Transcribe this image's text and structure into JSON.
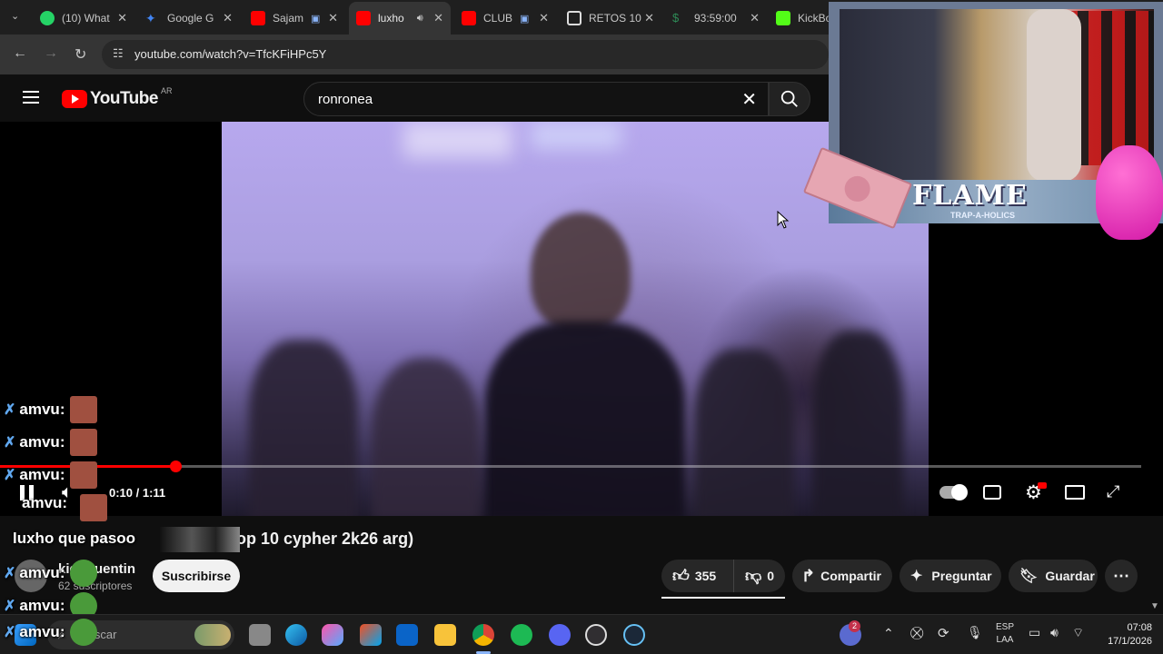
{
  "browser": {
    "tabs": [
      {
        "label": "(10) What",
        "color": "#25d366"
      },
      {
        "label": "Google G",
        "color": "#4285f4"
      },
      {
        "label": "Sajam",
        "color": "#ff0000"
      },
      {
        "label": "luxho",
        "color": "#ff0000"
      },
      {
        "label": "CLUB",
        "color": "#ff0000"
      },
      {
        "label": "RETOS 10",
        "color": "#dddddd"
      },
      {
        "label": "93:59:00",
        "color": "#2e8b57"
      },
      {
        "label": "KickBot",
        "color": "#53fc18"
      }
    ],
    "url": "youtube.com/watch?v=TfcKFiHPc5Y"
  },
  "youtube": {
    "logo": "YouTube",
    "country": "AR",
    "search_value": "ronronea"
  },
  "player": {
    "time": "0:10 / 1:11",
    "progress_fraction": 0.154
  },
  "overlay": {
    "webcam_banner": "FLAME",
    "webcam_sub": "TRAP-A-HOLICS",
    "chat": [
      {
        "user": "amvu:"
      },
      {
        "user": "amvu:"
      },
      {
        "user": "amvu:"
      },
      {
        "user": "amvu:"
      },
      {
        "user": "amvu:"
      },
      {
        "user": "amvu:"
      },
      {
        "user": "amvu:"
      }
    ],
    "chat_message": "luxho que pasoo"
  },
  "video_info": {
    "title_tail": "op 10 cypher 2k26 arg)",
    "channel_name": "kiddquentin",
    "subscribers": "62 suscriptores",
    "subscribe_label": "Suscribirse",
    "likes": "355",
    "dislikes": "0",
    "share_label": "Compartir",
    "ask_label": "Preguntar",
    "save_label": "Guardar"
  },
  "taskbar": {
    "search_placeholder": "Buscar",
    "lang_1": "ESP",
    "lang_2": "LAA",
    "time": "07:08",
    "date": "17/1/2026",
    "notification_count": "2"
  },
  "colors": {
    "accent_red": "#ff0000",
    "background": "#0f0f0f"
  }
}
